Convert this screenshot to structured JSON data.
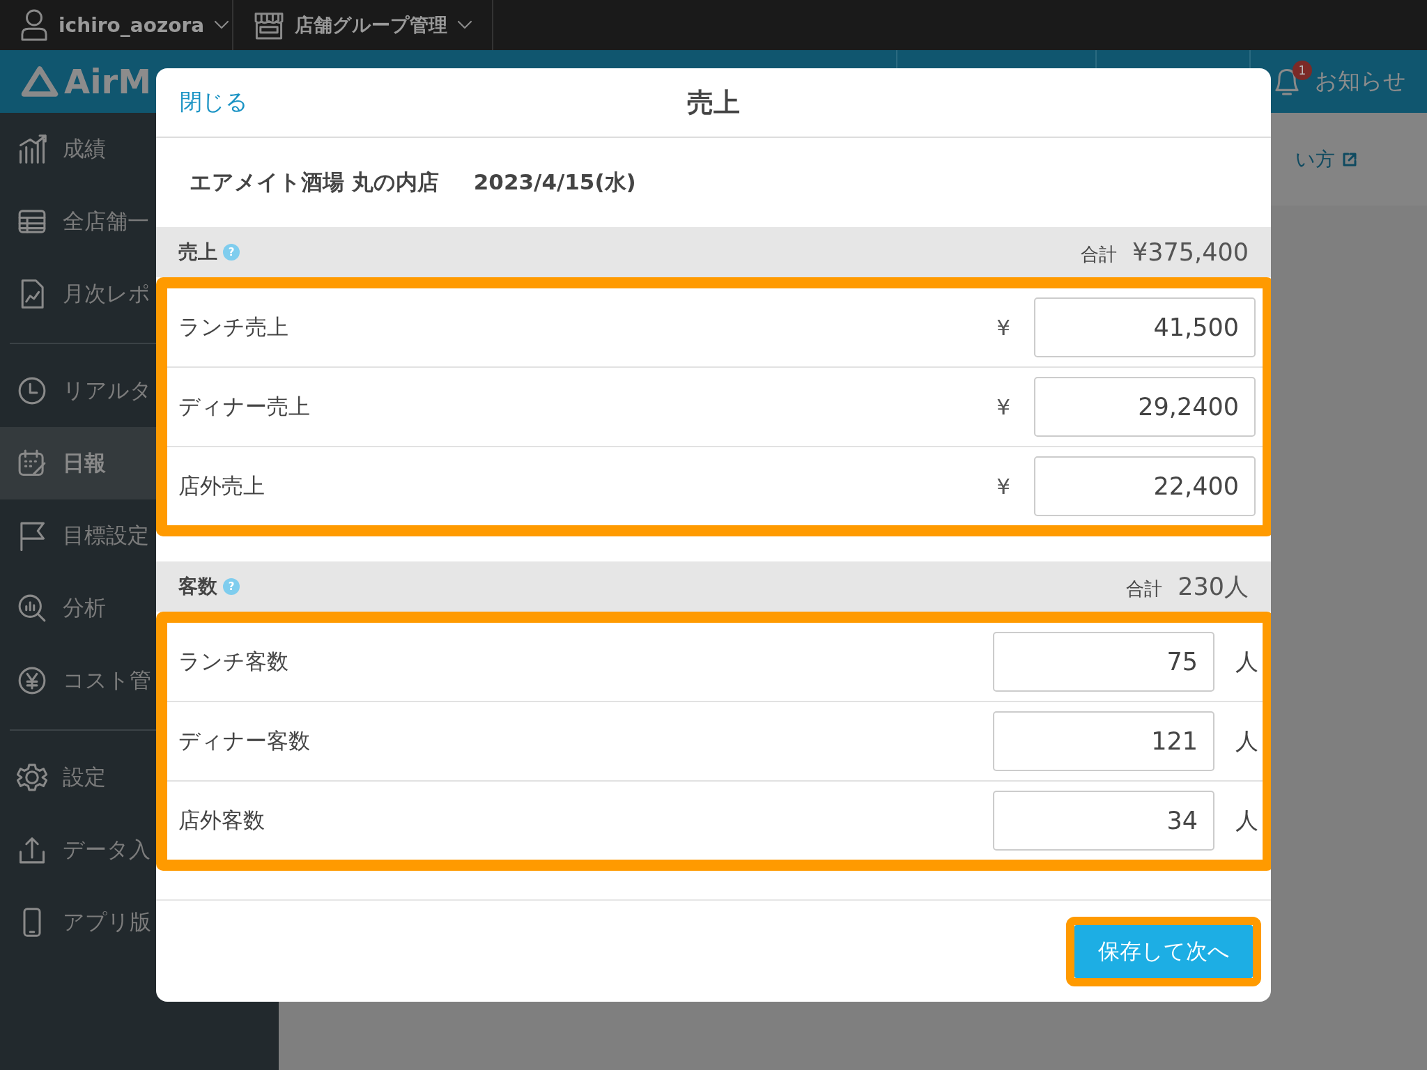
{
  "top_bar": {
    "user": "ichiro_aozora",
    "group": "店舗グループ管理"
  },
  "header": {
    "logo": "AirM",
    "notifications": {
      "label": "お知らせ",
      "badge": "1"
    }
  },
  "sidebar": {
    "groups": [
      [
        {
          "label": "成績",
          "kind": "chart",
          "selected": false
        },
        {
          "label": "全店舗一",
          "kind": "table",
          "selected": false
        },
        {
          "label": "月次レポ",
          "kind": "report",
          "selected": false
        }
      ],
      [
        {
          "label": "リアルタ",
          "kind": "clock",
          "selected": false
        },
        {
          "label": "日報",
          "kind": "calendar",
          "selected": true
        },
        {
          "label": "目標設定",
          "kind": "flag",
          "selected": false
        },
        {
          "label": "分析",
          "kind": "analysis",
          "selected": false
        },
        {
          "label": "コスト管",
          "kind": "yen",
          "selected": false
        }
      ],
      [
        {
          "label": "設定",
          "kind": "gear",
          "selected": false
        },
        {
          "label": "データ入",
          "kind": "upload",
          "selected": false
        },
        {
          "label": "アプリ版",
          "kind": "phone",
          "selected": false
        }
      ]
    ]
  },
  "help_link": {
    "label": "い方"
  },
  "modal": {
    "close": "閉じる",
    "title": "売上",
    "store": "エアメイト酒場 丸の内店",
    "date": "2023/4/15(水)",
    "sections": [
      {
        "title": "売上",
        "help": "?",
        "total_label": "合計",
        "total": "¥375,400",
        "highlighted": true,
        "rows": [
          {
            "label": "ランチ売上",
            "prefix": "¥",
            "value": "41,500"
          },
          {
            "label": "ディナー売上",
            "prefix": "¥",
            "value": "29,2400"
          },
          {
            "label": "店外売上",
            "prefix": "¥",
            "value": "22,400"
          }
        ]
      },
      {
        "title": "客数",
        "help": "?",
        "total_label": "合計",
        "total": "230人",
        "highlighted": true,
        "rows": [
          {
            "label": "ランチ客数",
            "suffix": "人",
            "value": "75"
          },
          {
            "label": "ディナー客数",
            "suffix": "人",
            "value": "121"
          },
          {
            "label": "店外客数",
            "suffix": "人",
            "value": "34"
          }
        ]
      }
    ],
    "save_button": {
      "label": "保存して次へ",
      "highlighted": true
    }
  }
}
